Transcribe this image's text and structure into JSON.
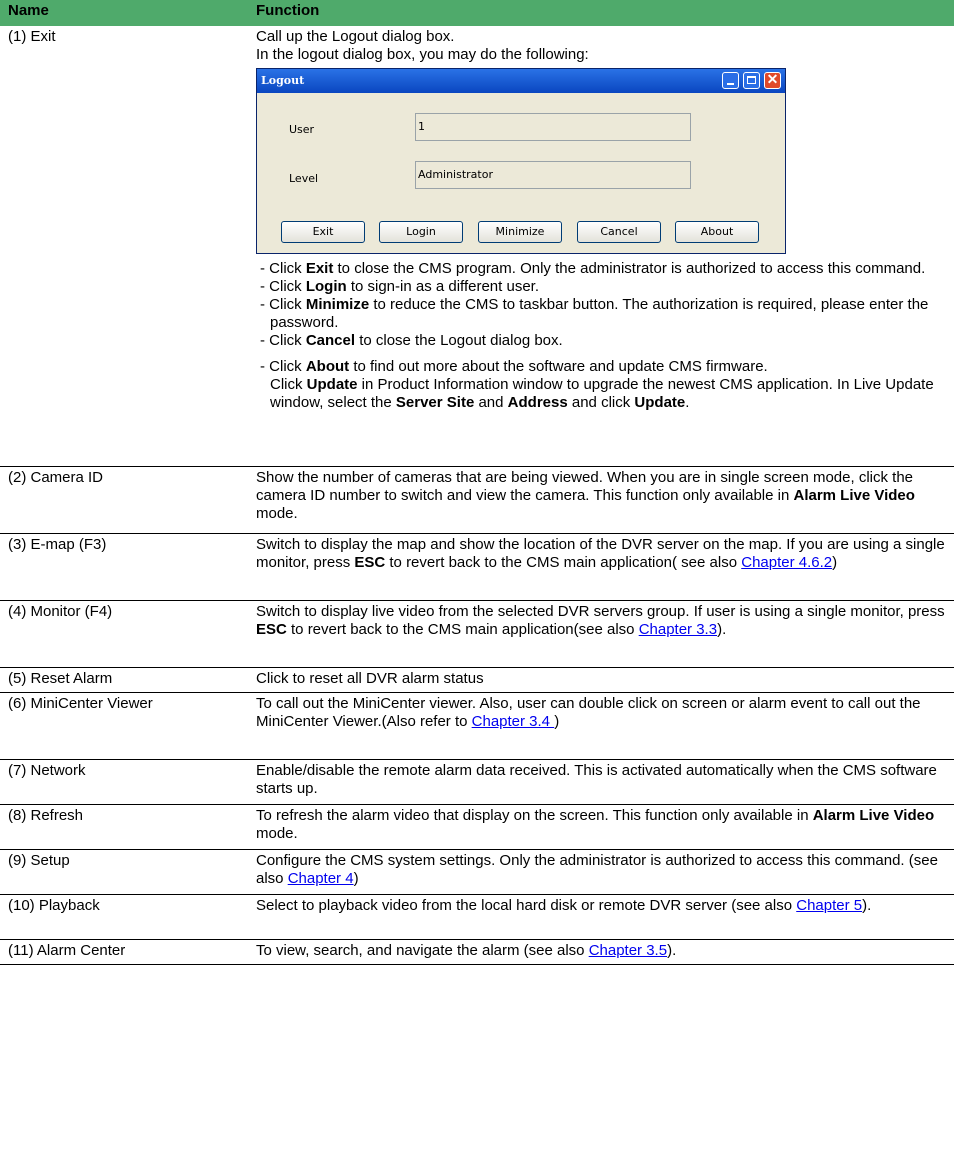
{
  "header": {
    "name": "Name",
    "function": "Function"
  },
  "exit": {
    "name": "(1) Exit",
    "line1": "Call up the Logout dialog box.",
    "line2": "In the logout dialog box, you may do the following:",
    "dialog": {
      "title": "Logout",
      "user_label": "User",
      "user_value": "1",
      "level_label": "Level",
      "level_value": "Administrator",
      "buttons": [
        "Exit",
        "Login",
        "Minimize",
        "Cancel",
        "About"
      ]
    },
    "b1_pre": "- Click ",
    "b1_bold": "Exit",
    "b1_post": " to close the CMS program. Only the administrator is authorized to access this command.",
    "b2_pre": "- Click ",
    "b2_bold": "Login",
    "b2_post": " to sign-in as a different user.",
    "b3_pre": "- Click ",
    "b3_bold": "Minimize",
    "b3_post": " to reduce the CMS to taskbar button. The authorization is required, please enter the password.",
    "b4_pre": "- Click ",
    "b4_bold": "Cancel",
    "b4_post": " to close the Logout dialog box.",
    "b5_pre": "- Click ",
    "b5_bold": "About",
    "b5_post": " to find out more about the software and update CMS firmware.",
    "upd_pre": "Click ",
    "upd_bold": "Update",
    "upd_mid": " in Product Information window to upgrade the newest CMS application. In Live Update window, select the ",
    "upd_b2": "Server Site",
    "upd_and": " and ",
    "upd_b3": "Address",
    "upd_mid2": " and click ",
    "upd_b4": "Update",
    "upd_end": "."
  },
  "rows": {
    "r2": {
      "name": "(2) Camera ID",
      "t1": "Show the number of cameras that are being viewed. When you are in single screen mode, click the camera ID number to switch and view the camera. This function only available in ",
      "b": "Alarm Live Video",
      "t2": " mode."
    },
    "r3": {
      "name": "(3) E-map (F3)",
      "t1": "Switch to display the map and show the location of the DVR server on the map. If you are using a single monitor, press ",
      "b": "ESC",
      "t2": " to revert back to the CMS main application( see also ",
      "link": "Chapter 4.6.2",
      "t3": ")"
    },
    "r4": {
      "name": "(4)  Monitor (F4)",
      "t1": "Switch to display live video from the selected DVR servers group. If user is using a single monitor, press ",
      "b": "ESC",
      "t2": " to revert back to the CMS main application(see also ",
      "link": "Chapter 3.3",
      "t3": ")."
    },
    "r5": {
      "name": "(5) Reset Alarm",
      "t1": "Click to reset all DVR alarm status"
    },
    "r6": {
      "name": "(6) MiniCenter Viewer",
      "t1": "To call out the MiniCenter viewer. Also, user can double click on screen or  alarm event to call out the MiniCenter Viewer.(Also refer to ",
      "link": "Chapter 3.4 ",
      "t3": ")"
    },
    "r7": {
      "name": "(7) Network",
      "t1": "Enable/disable the remote alarm data received. This is activated automatically when the CMS software starts up."
    },
    "r8": {
      "name": "(8) Refresh",
      "t1": "To refresh the alarm video that display on the screen. This function only available in ",
      "b": "Alarm Live Video",
      "t2": " mode."
    },
    "r9": {
      "name": "(9) Setup",
      "t1": "Configure the CMS system settings. Only the administrator is authorized to access this command. (see also ",
      "link": "Chapter 4",
      "t3": ")"
    },
    "r10": {
      "name": "(10) Playback",
      "t1": "Select to playback video from the local hard disk or remote DVR server (see also ",
      "link": "Chapter 5",
      "t3": ")."
    },
    "r11": {
      "name": "(11) Alarm Center",
      "t1": "To view, search, and navigate the alarm (see also ",
      "link": "Chapter 3.5",
      "t3": ")."
    }
  }
}
